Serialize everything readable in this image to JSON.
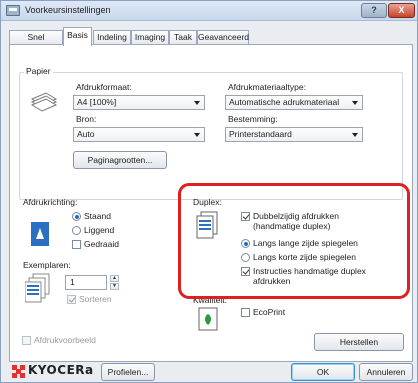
{
  "window": {
    "title": "Voorkeursinstellingen",
    "help_label": "?",
    "close_label": "X"
  },
  "tabs": [
    {
      "label": "Snel afdrukken",
      "active": false
    },
    {
      "label": "Basis",
      "active": true
    },
    {
      "label": "Indeling",
      "active": false
    },
    {
      "label": "Imaging",
      "active": false
    },
    {
      "label": "Taak",
      "active": false
    },
    {
      "label": "Geavanceerd",
      "active": false
    }
  ],
  "papier": {
    "title": "Papier",
    "formaat_label": "Afdrukformaat:",
    "formaat_value": "A4 [100%]",
    "bron_label": "Bron:",
    "bron_value": "Auto",
    "materiaal_label": "Afdrukmateriaaltype:",
    "materiaal_value": "Automatische adrukmateriaal",
    "bestemming_label": "Bestemming:",
    "bestemming_value": "Printerstandaard",
    "paginagrootten_label": "Paginagrootten..."
  },
  "afdrukrichting": {
    "title": "Afdrukrichting:",
    "staand": "Staand",
    "liggend": "Liggend",
    "gedraaid": "Gedraaid",
    "selected": "Staand"
  },
  "exemplaren": {
    "title": "Exemplaren:",
    "value": "1",
    "sorteren": "Sorteren"
  },
  "duplex": {
    "title": "Duplex:",
    "dubbelzijdig": "Dubbelzijdig afdrukken (handmatige duplex)",
    "lange_zijde": "Langs lange zijde spiegelen",
    "korte_zijde": "Langs korte zijde spiegelen",
    "instructies": "Instructies handmatige duplex afdrukken"
  },
  "kwaliteit": {
    "title": "Kwaliteit:",
    "ecoprint": "EcoPrint"
  },
  "afdrukvoorbeeld": "Afdrukvoorbeeld",
  "herstellen": "Herstellen",
  "footer": {
    "brand": "KYOCERa",
    "profielen": "Profielen...",
    "ok": "OK",
    "annuleren": "Annuleren"
  },
  "colors": {
    "highlight": "#e02020",
    "brand_red": "#e0302f"
  }
}
